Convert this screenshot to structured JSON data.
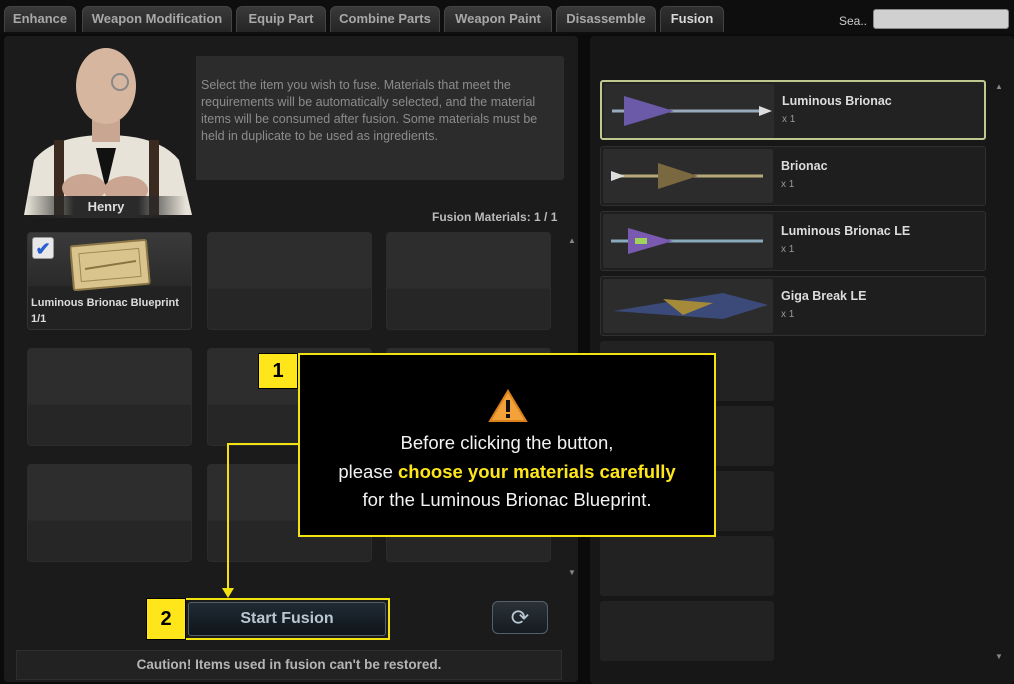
{
  "tabs": [
    {
      "label": "Enhance"
    },
    {
      "label": "Weapon Modification"
    },
    {
      "label": "Equip Part"
    },
    {
      "label": "Combine Parts"
    },
    {
      "label": "Weapon Paint"
    },
    {
      "label": "Disassemble"
    },
    {
      "label": "Fusion"
    }
  ],
  "active_tab": "Fusion",
  "search": {
    "label": "Sea..",
    "value": ""
  },
  "npc": {
    "name": "Henry"
  },
  "description": "Select the item you wish to fuse. Materials that meet the requirements will be automatically selected, and the material items will be consumed after fusion. Some materials must be held in duplicate to be used as ingredients.",
  "fusion_materials": "Fusion Materials: 1 / 1",
  "material_slot": {
    "title": "Luminous Brionac Blueprint",
    "count": "1/1",
    "checked": "✔"
  },
  "start_button": "Start Fusion",
  "refresh_icon": "refresh-icon",
  "caution": "Caution! Items used in fusion can't be restored.",
  "items": [
    {
      "name": "Luminous Brionac",
      "qty": "x 1"
    },
    {
      "name": "Brionac",
      "qty": "x 1"
    },
    {
      "name": "Luminous Brionac LE",
      "qty": "x 1"
    },
    {
      "name": "Giga Break LE",
      "qty": "x 1"
    }
  ],
  "callout": {
    "badge1": "1",
    "badge2": "2",
    "warning_icon": "warning-icon",
    "line1": "Before clicking the button,",
    "line2_prefix": "please ",
    "line2_highlight": "choose your materials carefully",
    "line3": "for the Luminous Brionac Blueprint."
  },
  "colors": {
    "accent": "#ffe61a",
    "selected_border": "#bfc88f"
  }
}
